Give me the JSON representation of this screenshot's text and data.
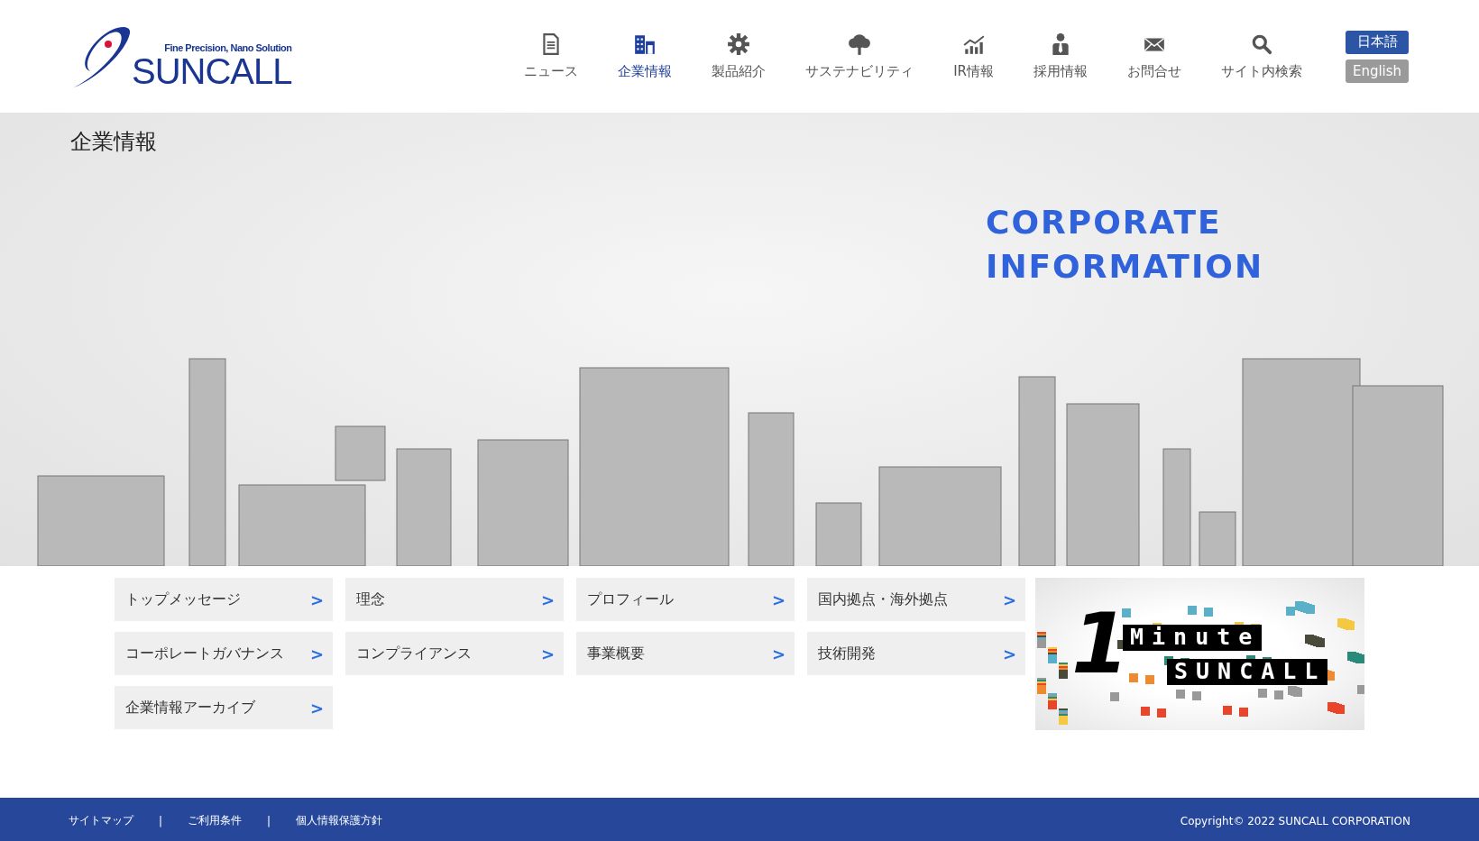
{
  "header": {
    "logo": {
      "tagline": "Fine Precision, Nano Solution",
      "name": "SUNCALL"
    },
    "nav": [
      {
        "label": "ニュース",
        "selected": false
      },
      {
        "label": "企業情報",
        "selected": true
      },
      {
        "label": "製品紹介",
        "selected": false
      },
      {
        "label": "サステナビリティ",
        "selected": false
      },
      {
        "label": "IR情報",
        "selected": false
      },
      {
        "label": "採用情報",
        "selected": false
      },
      {
        "label": "お問合せ",
        "selected": false
      },
      {
        "label": "サイト内検索",
        "selected": false
      }
    ],
    "languages": [
      {
        "label": "日本語",
        "selected": true
      },
      {
        "label": "English",
        "selected": false
      }
    ]
  },
  "hero": {
    "title": "企業情報",
    "heading_lines": [
      "CORPORATE",
      "INFORMATION"
    ]
  },
  "menu": [
    {
      "label": "トップメッセージ",
      "arrow": ">"
    },
    {
      "label": "理念",
      "arrow": ">"
    },
    {
      "label": "プロフィール",
      "arrow": ">"
    },
    {
      "label": "国内拠点・海外拠点",
      "arrow": ">"
    },
    {
      "label": "コーポレートガバナンス",
      "arrow": ">"
    },
    {
      "label": "コンプライアンス",
      "arrow": ">"
    },
    {
      "label": "事業概要",
      "arrow": ">"
    },
    {
      "label": "技術開発",
      "arrow": ">"
    },
    {
      "label": "企業情報アーカイブ",
      "arrow": ">"
    }
  ],
  "banner": {
    "number": "1",
    "line_1": "Minute",
    "line_2": "SUNCALL"
  },
  "footer": {
    "links": [
      "サイトマップ",
      "ご利用条件",
      "個人情報保護方針"
    ],
    "separators": [
      "|",
      "|"
    ],
    "copyright": "Copyright© 2022 SUNCALL CORPORATION"
  }
}
